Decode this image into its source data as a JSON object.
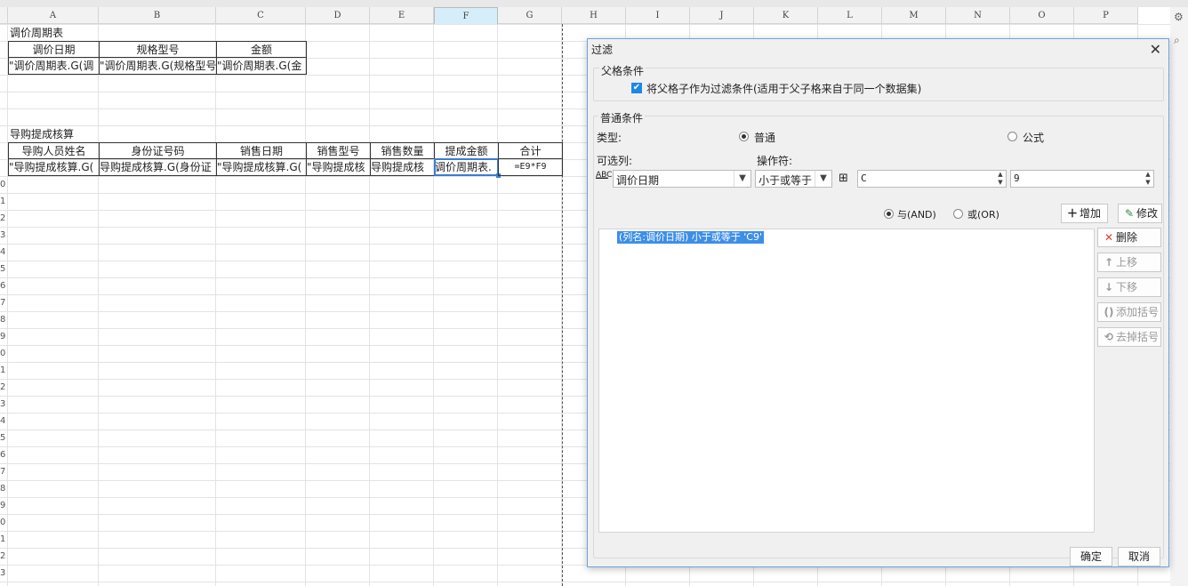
{
  "sheet": {
    "columns": [
      "A",
      "B",
      "C",
      "D",
      "E",
      "F",
      "G",
      "H",
      "I",
      "J",
      "K",
      "L",
      "M",
      "N",
      "O",
      "P"
    ],
    "row_numbers": [
      "0",
      "1",
      "2",
      "3",
      "4",
      "5",
      "6",
      "7",
      "8",
      "9",
      "0",
      "1",
      "2",
      "3",
      "4",
      "5",
      "6",
      "7",
      "8",
      "9",
      "0",
      "1",
      "2",
      "3"
    ],
    "section1_title": "调价周期表",
    "section1_headers": [
      "调价日期",
      "规格型号",
      "金额"
    ],
    "section1_values": [
      "\"调价周期表.G(调",
      "\"调价周期表.G(规格型号",
      "\"调价周期表.G(金"
    ],
    "section2_title": "导购提成核算",
    "section2_headers": [
      "导购人员姓名",
      "身份证号码",
      "销售日期",
      "销售型号",
      "销售数量",
      "提成金额",
      "合计"
    ],
    "section2_values": [
      "\"导购提成核算.G(",
      "导购提成核算.G(身份证",
      "\"导购提成核算.G(",
      "\"导购提成核",
      "导购提成核",
      "调价周期表.",
      "=E9*F9"
    ]
  },
  "dialog": {
    "title": "过滤",
    "close_glyph": "✕",
    "parent_section_title": "父格条件",
    "parent_checkbox_label": "将父格子作为过滤条件(适用于父子格来自于同一个数据集)",
    "normal_section_title": "普通条件",
    "type_label": "类型:",
    "type_option_normal": "普通",
    "type_option_formula": "公式",
    "column_label": "可选列:",
    "column_value": "调价日期",
    "operator_label": "操作符:",
    "operator_value": "小于或等于",
    "value_col": "C",
    "value_row": "9",
    "and_label": "与(AND)",
    "or_label": "或(OR)",
    "add_label": "增加",
    "modify_label": "修改",
    "conditions": [
      "(列名:调价日期) 小于或等于 'C9'"
    ],
    "delete_label": "删除",
    "move_up_label": "上移",
    "move_down_label": "下移",
    "add_bracket_label": "添加括号",
    "remove_bracket_label": "去掉括号",
    "ok_label": "确定",
    "cancel_label": "取消"
  }
}
